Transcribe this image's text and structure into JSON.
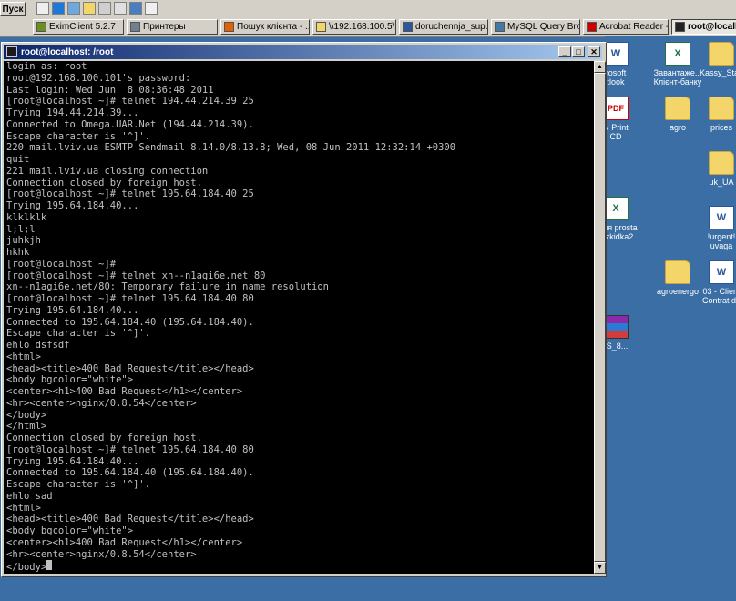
{
  "taskbar": {
    "start_label": "Пуск",
    "tasks": [
      {
        "label": "EximClient 5.2.7",
        "icon": "app-icon",
        "color": "#6b8e23"
      },
      {
        "label": "Принтеры",
        "icon": "printer-icon",
        "color": "#708090"
      },
      {
        "label": "Пошук клієнта - ...",
        "icon": "firefox-icon",
        "color": "#e66000"
      },
      {
        "label": "\\\\192.168.100.5\\...",
        "icon": "folder-icon",
        "color": "#f4d56a"
      },
      {
        "label": "doruchennja_sup...",
        "icon": "word-icon",
        "color": "#2b579a"
      },
      {
        "label": "MySQL Query Bro...",
        "icon": "mysql-icon",
        "color": "#4479a1"
      },
      {
        "label": "Acrobat Reader -...",
        "icon": "acrobat-icon",
        "color": "#cc0000"
      },
      {
        "label": "root@localho...",
        "icon": "putty-icon",
        "color": "#222222"
      }
    ]
  },
  "window": {
    "title": "root@localhost: /root",
    "buttons": {
      "minimize": "_",
      "maximize": "□",
      "close": "✕"
    }
  },
  "terminal": {
    "lines": [
      "login as: root",
      "root@192.168.100.101's password:",
      "Last login: Wed Jun  8 08:36:48 2011",
      "[root@localhost ~]# telnet 194.44.214.39 25",
      "Trying 194.44.214.39...",
      "Connected to Omega.UAR.Net (194.44.214.39).",
      "Escape character is '^]'.",
      "220 mail.lviv.ua ESMTP Sendmail 8.14.0/8.13.8; Wed, 08 Jun 2011 12:32:14 +0300",
      "quit",
      "221 mail.lviv.ua closing connection",
      "Connection closed by foreign host.",
      "[root@localhost ~]# telnet 195.64.184.40 25",
      "Trying 195.64.184.40...",
      "klklklk",
      "l;l;l",
      "juhkjh",
      "hkhk",
      "[root@localhost ~]#",
      "[root@localhost ~]# telnet xn--n1agi6e.net 80",
      "xn--n1agi6e.net/80: Temporary failure in name resolution",
      "[root@localhost ~]# telnet 195.64.184.40 80",
      "Trying 195.64.184.40...",
      "Connected to 195.64.184.40 (195.64.184.40).",
      "Escape character is '^]'.",
      "ehlo dsfsdf",
      "<html>",
      "<head><title>400 Bad Request</title></head>",
      "<body bgcolor=\"white\">",
      "<center><h1>400 Bad Request</h1></center>",
      "<hr><center>nginx/0.8.54</center>",
      "</body>",
      "</html>",
      "Connection closed by foreign host.",
      "[root@localhost ~]# telnet 195.64.184.40 80",
      "Trying 195.64.184.40...",
      "Connected to 195.64.184.40 (195.64.184.40).",
      "Escape character is '^]'.",
      "ehlo sad",
      "<html>",
      "<head><title>400 Bad Request</title></head>",
      "<body bgcolor=\"white\">",
      "<center><h1>400 Bad Request</h1></center>",
      "<hr><center>nginx/0.8.54</center>",
      "</body>"
    ]
  },
  "desktop": {
    "icons": [
      {
        "label": "rosoft\ntlook",
        "type": "docx"
      },
      {
        "label": "Завантаже...\nКлієнт-банку",
        "type": "xlsx"
      },
      {
        "label": "Kassy_Stan",
        "type": "folder"
      },
      {
        "label": "N Print\nCD",
        "type": "pdf"
      },
      {
        "label": "agro",
        "type": "folder"
      },
      {
        "label": "prices",
        "type": "folder"
      },
      {
        "label": "uk_UA",
        "type": "folder"
      },
      {
        "label": "опия prosta\nrozkidka2",
        "type": "xlsx"
      },
      {
        "label": "!urgent!\nuvaga",
        "type": "docx"
      },
      {
        "label": "agroenergo",
        "type": "folder"
      },
      {
        "label": "03 - Client\nContrat da",
        "type": "docx"
      },
      {
        "label": "ZS_8....",
        "type": "rar"
      }
    ]
  }
}
